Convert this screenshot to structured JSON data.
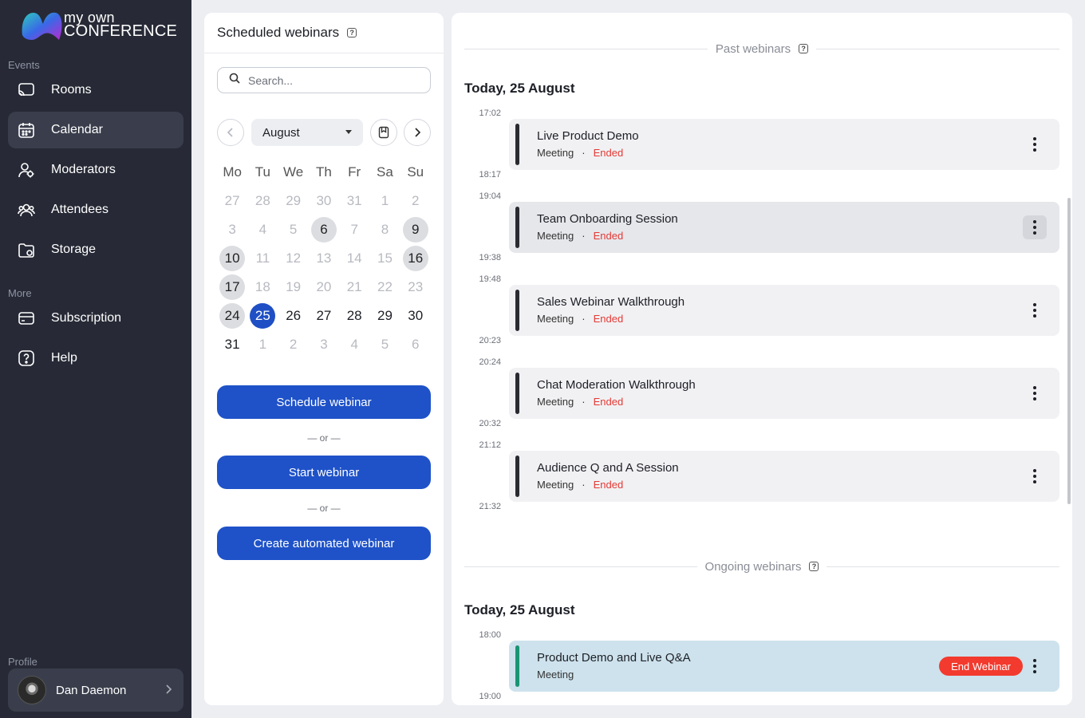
{
  "brand": {
    "line1": "my own",
    "line2": "CONFERENCE"
  },
  "sidebar": {
    "events_label": "Events",
    "more_label": "More",
    "profile_label": "Profile",
    "items": [
      {
        "label": "Rooms",
        "icon": "cast-icon"
      },
      {
        "label": "Calendar",
        "icon": "calendar-icon",
        "active": true
      },
      {
        "label": "Moderators",
        "icon": "moderator-icon"
      },
      {
        "label": "Attendees",
        "icon": "attendees-icon"
      },
      {
        "label": "Storage",
        "icon": "folder-icon"
      }
    ],
    "more_items": [
      {
        "label": "Subscription",
        "icon": "card-icon"
      },
      {
        "label": "Help",
        "icon": "help-icon"
      }
    ],
    "user_name": "Dan Daemon"
  },
  "scheduled": {
    "title": "Scheduled webinars",
    "search_placeholder": "Search...",
    "month": "August",
    "weekdays": [
      "Mo",
      "Tu",
      "We",
      "Th",
      "Fr",
      "Sa",
      "Su"
    ],
    "weeks": [
      [
        "27",
        "28",
        "29",
        "30",
        "31",
        "1",
        "2"
      ],
      [
        "3",
        "4",
        "5",
        "6",
        "7",
        "8",
        "9"
      ],
      [
        "10",
        "11",
        "12",
        "13",
        "14",
        "15",
        "16"
      ],
      [
        "17",
        "18",
        "19",
        "20",
        "21",
        "22",
        "23"
      ],
      [
        "24",
        "25",
        "26",
        "27",
        "28",
        "29",
        "30"
      ],
      [
        "31",
        "1",
        "2",
        "3",
        "4",
        "5",
        "6"
      ]
    ],
    "schedule_button": "Schedule webinar",
    "or_text": "— or —",
    "start_button": "Start webinar",
    "automated_button": "Create automated webinar"
  },
  "past": {
    "title": "Past webinars",
    "day": "Today, 25 August",
    "events": [
      {
        "start": "17:02",
        "end": "18:17",
        "title": "Live Product Demo",
        "type": "Meeting",
        "status": "Ended"
      },
      {
        "start": "19:04",
        "end": "19:38",
        "title": "Team Onboarding Session",
        "type": "Meeting",
        "status": "Ended"
      },
      {
        "start": "19:48",
        "end": "20:23",
        "title": "Sales Webinar Walkthrough",
        "type": "Meeting",
        "status": "Ended"
      },
      {
        "start": "20:24",
        "end": "20:32",
        "title": "Chat Moderation Walkthrough",
        "type": "Meeting",
        "status": "Ended"
      },
      {
        "start": "21:12",
        "end": "21:32",
        "title": "Audience Q and A Session",
        "type": "Meeting",
        "status": "Ended"
      }
    ]
  },
  "ongoing": {
    "title": "Ongoing webinars",
    "day": "Today, 25 August",
    "events": [
      {
        "start": "18:00",
        "end": "19:00",
        "title": "Product Demo and Live Q&A",
        "type": "Meeting",
        "action": "End Webinar"
      }
    ]
  },
  "colors": {
    "accent": "#1f52c8",
    "sidebar": "#272a36",
    "ended": "#e53935",
    "live_bar": "#1a9473",
    "end_button": "#f33a2e"
  }
}
